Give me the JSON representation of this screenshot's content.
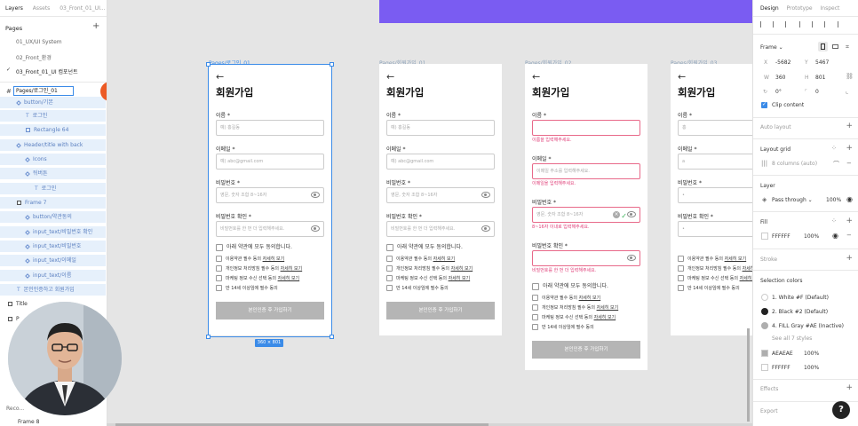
{
  "left_panel": {
    "tabs": [
      "Layers",
      "Assets",
      "03_Front_01_UI..."
    ],
    "pages_header": "Pages",
    "pages": [
      "01_UX/UI System",
      "02_Front_환경",
      "03_Front_01_UI 컴포넌트"
    ],
    "active_page_index": 2,
    "selected_layer_name": "Pages/로그인_01",
    "badge": "1",
    "layers": [
      {
        "label": "button/기본",
        "indent": 1,
        "icon": "diamond"
      },
      {
        "label": "로그인",
        "indent": 2,
        "icon": "text"
      },
      {
        "label": "Rectangle 64",
        "indent": 2,
        "icon": "rect"
      },
      {
        "label": "Header/title with back",
        "indent": 1,
        "icon": "diamond"
      },
      {
        "label": "Icons",
        "indent": 2,
        "icon": "diamond"
      },
      {
        "label": "뒤버튼",
        "indent": 2,
        "icon": "diamond"
      },
      {
        "label": "로그인",
        "indent": 3,
        "icon": "text"
      },
      {
        "label": "Frame 7",
        "indent": 1,
        "icon": "grid"
      },
      {
        "label": "button/약관동의",
        "indent": 2,
        "icon": "diamond"
      },
      {
        "label": "input_text/비밀번호 확인",
        "indent": 2,
        "icon": "diamond"
      },
      {
        "label": "input_text/비밀번호",
        "indent": 2,
        "icon": "diamond"
      },
      {
        "label": "input_text/이메일",
        "indent": 2,
        "icon": "diamond"
      },
      {
        "label": "input_text/이름",
        "indent": 2,
        "icon": "diamond"
      },
      {
        "label": "본인인증하고 회원가입",
        "indent": 1,
        "icon": "text"
      },
      {
        "label": "Title",
        "indent": 0,
        "icon": "grid",
        "plain": true
      },
      {
        "label": "P",
        "indent": 0,
        "icon": "grid",
        "plain": true
      }
    ],
    "bottom_layers": [
      "Reco...",
      "Frame 8"
    ]
  },
  "canvas": {
    "selection_size": "360 × 801",
    "frames": [
      {
        "label": "Pages/로그인_01",
        "selected": true,
        "title": "회원가입",
        "back": "←",
        "fields": [
          {
            "label": "이름 *",
            "placeholder": "예) 홍길동",
            "error": "",
            "icon": ""
          },
          {
            "label": "이메일 *",
            "placeholder": "예) abc@gmail.com",
            "error": "",
            "icon": ""
          },
          {
            "label": "비밀번호 *",
            "placeholder": "영문, 숫자 조합 8~16자",
            "error": "",
            "icon": "eye"
          },
          {
            "label": "비밀번호 확인 *",
            "placeholder": "비밀번호를 한 번 더 입력해주세요.",
            "error": "",
            "icon": "eye"
          }
        ],
        "agree_all": "아래 약관에 모두 동의합니다.",
        "agree_items": [
          {
            "text": "이용약관 필수 동의",
            "link": "자세히 보기"
          },
          {
            "text": "개인정보 처리방침 필수 동의",
            "link": "자세히 보기"
          },
          {
            "text": "마케팅 정보 수신 선택 동의",
            "link": "자세히 보기"
          },
          {
            "text": "만 14세 이상임에 필수 동의",
            "link": ""
          }
        ],
        "button": "본인인증 후 가입하기"
      },
      {
        "label": "Pages/회원가입_01",
        "selected": false,
        "title": "회원가입",
        "back": "←",
        "fields": [
          {
            "label": "이름 *",
            "placeholder": "예) 홍길동",
            "error": "",
            "icon": ""
          },
          {
            "label": "이메일 *",
            "placeholder": "예) abc@gmail.com",
            "error": "",
            "icon": ""
          },
          {
            "label": "비밀번호 *",
            "placeholder": "영문, 숫자 조합 8~16자",
            "error": "",
            "icon": "eye"
          },
          {
            "label": "비밀번호 확인 *",
            "placeholder": "비밀번호를 한 번 더 입력해주세요.",
            "error": "",
            "icon": "eye"
          }
        ],
        "agree_all": "아래 약관에 모두 동의합니다.",
        "agree_items": [
          {
            "text": "이용약관 필수 동의",
            "link": "자세히 보기"
          },
          {
            "text": "개인정보 처리방침 필수 동의",
            "link": "자세히 보기"
          },
          {
            "text": "마케팅 정보 수신 선택 동의",
            "link": "자세히 보기"
          },
          {
            "text": "만 14세 이상임에 필수 동의",
            "link": ""
          }
        ],
        "button": "본인인증 후 가입하기"
      },
      {
        "label": "Pages/회원가입_02",
        "selected": false,
        "title": "회원가입",
        "back": "←",
        "fields": [
          {
            "label": "이름 *",
            "placeholder": "",
            "error": "이름을 입력해주세요.",
            "icon": ""
          },
          {
            "label": "이메일 *",
            "placeholder": "이메일 주소를 입력해주세요.",
            "error": "이메일을 입력해주세요.",
            "icon": ""
          },
          {
            "label": "비밀번호 *",
            "placeholder": "영문, 숫자 조합 8~16자",
            "error": "8~16자 이내로 입력해주세요.",
            "icon": "eye-check"
          },
          {
            "label": "비밀번호 확인 *",
            "placeholder": "",
            "error": "비밀번호를 한 번 더 입력해주세요.",
            "icon": "eye"
          }
        ],
        "agree_all": "아래 약관에 모두 동의합니다.",
        "agree_items": [
          {
            "text": "이용약관 필수 동의",
            "link": "자세히 보기"
          },
          {
            "text": "개인정보 처리방침 필수 동의",
            "link": "자세히 보기"
          },
          {
            "text": "마케팅 정보 수신 선택 동의",
            "link": "자세히 보기"
          },
          {
            "text": "만 14세 이상임에 필수 동의",
            "link": ""
          }
        ],
        "button": "본인인증 후 가입하기"
      },
      {
        "label": "Pages/회원가입_03",
        "selected": false,
        "title": "회원가입",
        "back": "←",
        "fields": [
          {
            "label": "이름 *",
            "placeholder": "홍",
            "error": "",
            "icon": ""
          },
          {
            "label": "이메일 *",
            "placeholder": "a",
            "error": "",
            "icon": ""
          },
          {
            "label": "비밀번호 *",
            "placeholder": "•",
            "error": "",
            "icon": ""
          },
          {
            "label": "비밀번호 확인 *",
            "placeholder": "•",
            "error": "",
            "icon": ""
          }
        ],
        "agree_all": "",
        "agree_items": [
          {
            "text": "이용약관 필수 동의",
            "link": "자세히 보기"
          },
          {
            "text": "개인정보 처리방침 필수 동의",
            "link": "자세히 보기"
          },
          {
            "text": "마케팅 정보 수신 선택 동의",
            "link": "자세히 보기"
          },
          {
            "text": "만 14세 이상임에 필수 동의",
            "link": ""
          }
        ],
        "button": ""
      }
    ]
  },
  "right_panel": {
    "tabs": [
      "Design",
      "Prototype",
      "Inspect"
    ],
    "frame_label": "Frame ⌄",
    "x_label": "X",
    "x_value": "-5682",
    "y_label": "Y",
    "y_value": "5467",
    "w_label": "W",
    "w_value": "360",
    "h_label": "H",
    "h_value": "801",
    "rotation": "0°",
    "radius": "0",
    "clip_content": "Clip content",
    "auto_layout": "Auto layout",
    "layout_grid": "Layout grid",
    "grid_value": "8 columns (auto)",
    "layer": "Layer",
    "pass_through": "Pass through ⌄",
    "layer_opacity": "100%",
    "fill": "Fill",
    "fill_hex": "FFFFFF",
    "fill_opacity": "100%",
    "stroke": "Stroke",
    "selection_colors": "Selection colors",
    "colors": [
      {
        "label": "1. White #F (Default)",
        "hex": "#ffffff"
      },
      {
        "label": "2. Black #2 (Default)",
        "hex": "#222222"
      },
      {
        "label": "4. FILL Gray #AE (Inactive)",
        "hex": "#aeaeae"
      }
    ],
    "see_all": "See all 7 styles",
    "extra_colors": [
      {
        "hex_text": "AEAEAE",
        "opacity": "100%",
        "hex": "#aeaeae"
      },
      {
        "hex_text": "FFFFFF",
        "opacity": "100%",
        "hex": "#ffffff"
      }
    ],
    "effects": "Effects",
    "export": "Export",
    "help": "?"
  },
  "accent": "#3b8be8",
  "top_bar_color": "#7a5cf2"
}
